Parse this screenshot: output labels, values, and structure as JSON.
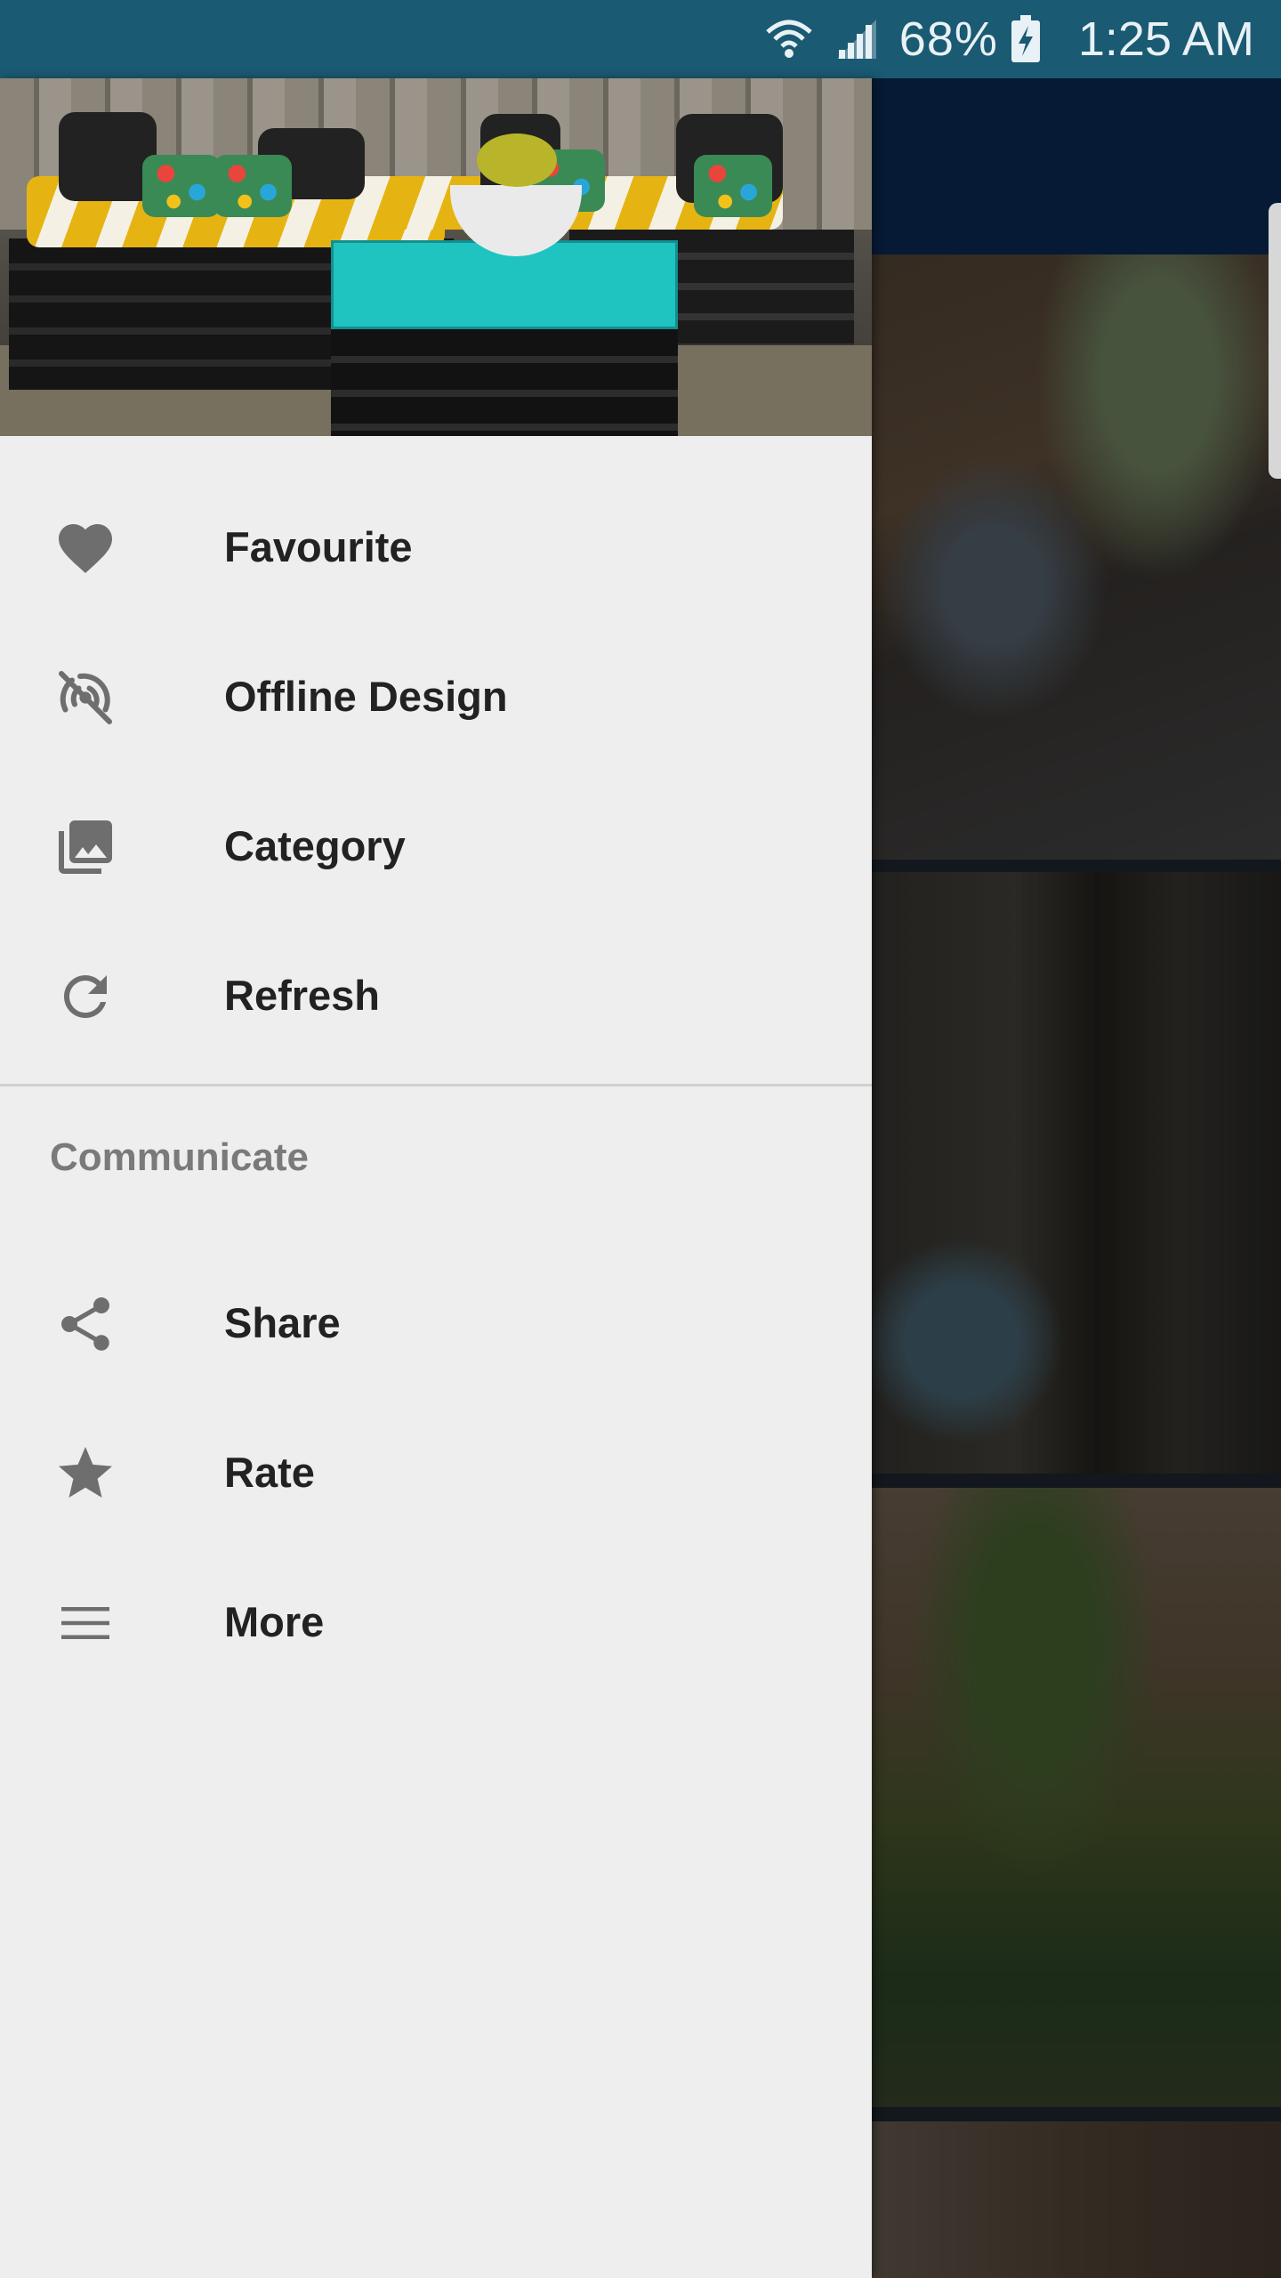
{
  "status_bar": {
    "battery_percent": "68%",
    "time": "1:25 AM",
    "icons": [
      "wifi-icon",
      "signal-icon",
      "battery-charging-icon"
    ]
  },
  "drawer": {
    "header_image": "garden pallet furniture with yellow striped cushions and turquoise table",
    "primary_items": [
      {
        "icon": "heart-icon",
        "label": "Favourite"
      },
      {
        "icon": "offline-icon",
        "label": "Offline Design"
      },
      {
        "icon": "photo-library-icon",
        "label": "Category"
      },
      {
        "icon": "refresh-icon",
        "label": "Refresh"
      }
    ],
    "section_title": "Communicate",
    "secondary_items": [
      {
        "icon": "share-icon",
        "label": "Share"
      },
      {
        "icon": "star-icon",
        "label": "Rate"
      },
      {
        "icon": "menu-lines-icon",
        "label": "More"
      }
    ]
  },
  "colors": {
    "status_bar": "#1a5a72",
    "app_bar": "#0c2d5c",
    "drawer_bg": "#eeeeee",
    "icon_gray": "#6e6e6e",
    "label_text": "#222222",
    "section_text": "#7a7a7a"
  }
}
